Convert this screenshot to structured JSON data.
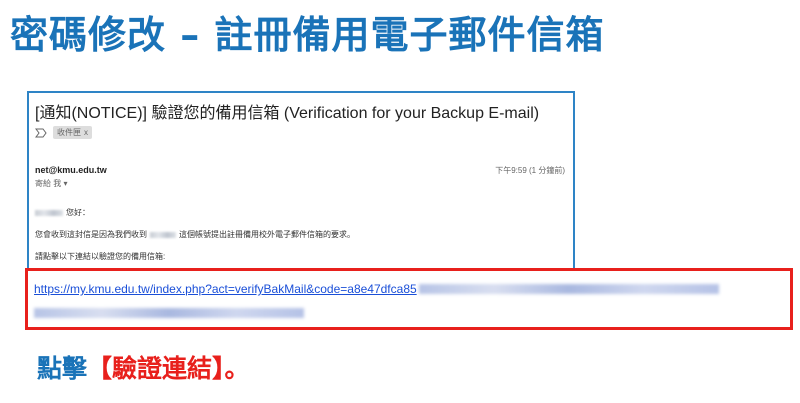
{
  "slide": {
    "title": "密碼修改 – 註冊備用電子郵件信箱",
    "instruction_prefix": "點擊",
    "instruction_highlight": "【驗證連結】",
    "instruction_suffix": "。"
  },
  "email": {
    "subject": "[通知(NOTICE)] 驗證您的備用信箱 (Verification for your Backup E-mail)",
    "label": "收件匣",
    "label_close": "x",
    "sender": "net@kmu.edu.tw",
    "time": "下午9:59 (1 分鐘前)",
    "to": "寄給 我 ▾",
    "greeting": "您好：",
    "line1_prefix": "您會收到這封信是因為我們收到",
    "line1_suffix": "這個帳號提出註冊備用校外電子郵件信箱的要求。",
    "line2": "請點擊以下連結以驗證您的備用信箱:",
    "link": "https://my.kmu.edu.tw/index.php?act=verifyBakMail&code=a8e47dfca85"
  },
  "colors": {
    "title": "#1a73b8",
    "highlight": "#e8201c",
    "link": "#1a4fd8",
    "email_border": "#2e84c6"
  }
}
